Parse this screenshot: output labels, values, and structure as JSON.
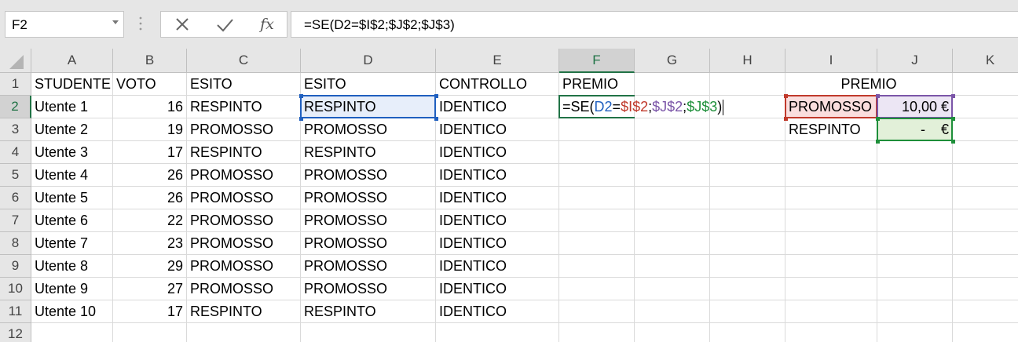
{
  "name_box": {
    "value": "F2"
  },
  "formula_bar": {
    "formula": "=SE(D2=$I$2;$J$2;$J$3)",
    "fx_label": "fx",
    "cancel_icon": "x-icon",
    "enter_icon": "check-icon"
  },
  "columns": [
    "A",
    "B",
    "C",
    "D",
    "E",
    "F",
    "G",
    "H",
    "I",
    "J",
    "K"
  ],
  "selected_column": "F",
  "rows": [
    "1",
    "2",
    "3",
    "4",
    "5",
    "6",
    "7",
    "8",
    "9",
    "10",
    "11",
    "12"
  ],
  "selected_row": "2",
  "headers": {
    "a": "STUDENTE",
    "b": "VOTO",
    "c": "ESITO",
    "d": "ESITO",
    "e": "CONTROLLO",
    "f": "PREMIO",
    "ij": "PREMIO"
  },
  "students": [
    {
      "name": "Utente 1",
      "voto": "16",
      "esito": "RESPINTO",
      "esito2": "RESPINTO",
      "controllo": "IDENTICO"
    },
    {
      "name": "Utente 2",
      "voto": "19",
      "esito": "PROMOSSO",
      "esito2": "PROMOSSO",
      "controllo": "IDENTICO"
    },
    {
      "name": "Utente 3",
      "voto": "17",
      "esito": "RESPINTO",
      "esito2": "RESPINTO",
      "controllo": "IDENTICO"
    },
    {
      "name": "Utente 4",
      "voto": "26",
      "esito": "PROMOSSO",
      "esito2": "PROMOSSO",
      "controllo": "IDENTICO"
    },
    {
      "name": "Utente 5",
      "voto": "26",
      "esito": "PROMOSSO",
      "esito2": "PROMOSSO",
      "controllo": "IDENTICO"
    },
    {
      "name": "Utente 6",
      "voto": "22",
      "esito": "PROMOSSO",
      "esito2": "PROMOSSO",
      "controllo": "IDENTICO"
    },
    {
      "name": "Utente 7",
      "voto": "23",
      "esito": "PROMOSSO",
      "esito2": "PROMOSSO",
      "controllo": "IDENTICO"
    },
    {
      "name": "Utente 8",
      "voto": "29",
      "esito": "PROMOSSO",
      "esito2": "PROMOSSO",
      "controllo": "IDENTICO"
    },
    {
      "name": "Utente 9",
      "voto": "27",
      "esito": "PROMOSSO",
      "esito2": "PROMOSSO",
      "controllo": "IDENTICO"
    },
    {
      "name": "Utente 10",
      "voto": "17",
      "esito": "RESPINTO",
      "esito2": "RESPINTO",
      "controllo": "IDENTICO"
    }
  ],
  "lookup": [
    {
      "label": "PROMOSSO",
      "premio": "10,00 €"
    },
    {
      "label": "RESPINTO",
      "premio": "-    €"
    }
  ],
  "edit_formula": {
    "prefix": "=SE(",
    "ref_d": "D2",
    "eq": "=",
    "ref_i": "$I$2",
    "sep1": ";",
    "ref_j2": "$J$2",
    "sep2": ";",
    "ref_j3": "$J$3",
    "suffix": ")"
  },
  "colors": {
    "accent": "#217346",
    "ref_d": "#1f5fbf",
    "ref_i": "#c0392b",
    "ref_j2": "#7b55a8",
    "ref_j3": "#1e8f3a"
  }
}
